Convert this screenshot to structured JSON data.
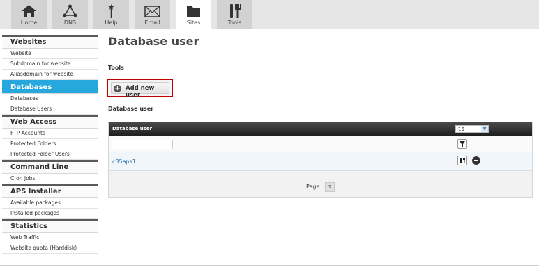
{
  "nav_tabs": [
    {
      "label": "Home",
      "icon": "home-icon"
    },
    {
      "label": "DNS",
      "icon": "dns-network-icon"
    },
    {
      "label": "Help",
      "icon": "help-wand-icon"
    },
    {
      "label": "Email",
      "icon": "email-envelope-icon"
    },
    {
      "label": "Sites",
      "icon": "folder-icon",
      "active": true
    },
    {
      "label": "Tools",
      "icon": "tools-icon"
    }
  ],
  "sidebar": {
    "sections": [
      {
        "title": "Websites",
        "items": [
          "Website",
          "Subdomain for website",
          "Aliasdomain for website"
        ]
      },
      {
        "title": "Databases",
        "active": true,
        "items": [
          "Databases",
          "Database Users"
        ]
      },
      {
        "title": "Web Access",
        "items": [
          "FTP-Accounts",
          "Protected Folders",
          "Protected Folder Users"
        ]
      },
      {
        "title": "Command Line",
        "items": [
          "Cron Jobs"
        ]
      },
      {
        "title": "APS Installer",
        "items": [
          "Available packages",
          "Installed packages"
        ]
      },
      {
        "title": "Statistics",
        "items": [
          "Web Traffic",
          "Website quota (Harddisk)"
        ]
      }
    ]
  },
  "main": {
    "title": "Database user",
    "tools_heading": "Tools",
    "add_button": "Add new user",
    "list_title": "Database user",
    "grid": {
      "column_header": "Database user",
      "page_size": "15",
      "rows": [
        {
          "name": "c35aps1"
        }
      ],
      "pager_label": "Page",
      "current_page": "1"
    }
  },
  "colors": {
    "accent": "#27a8dd",
    "highlight_border": "#c00000",
    "link": "#2a6fa8"
  }
}
